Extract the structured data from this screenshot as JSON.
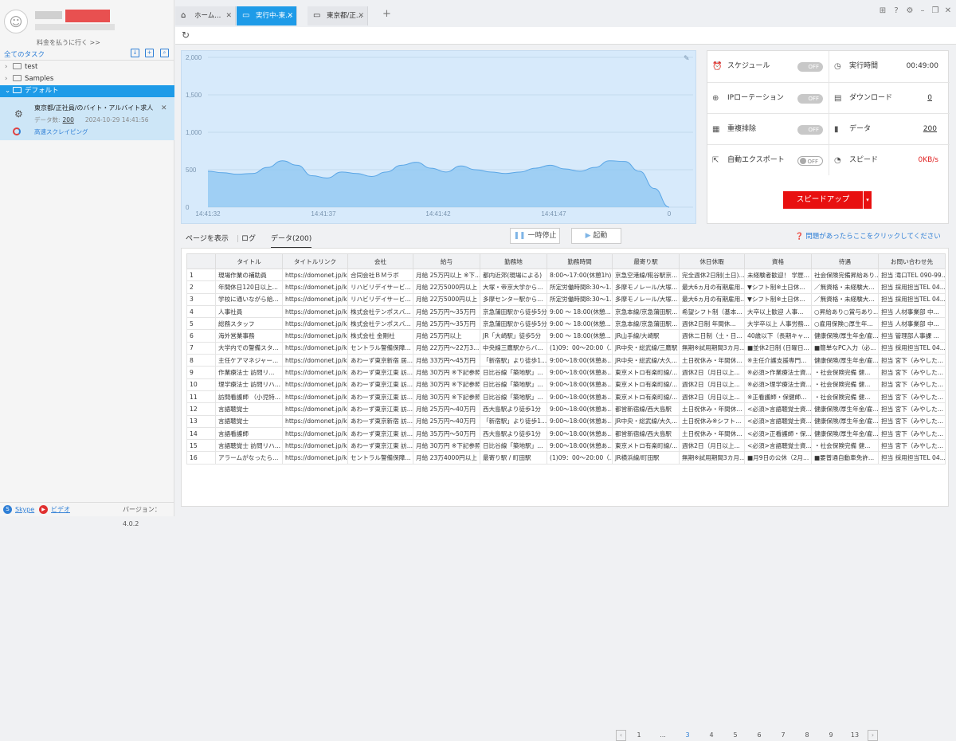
{
  "sidebar": {
    "pay_link": "料金を払うに行く >>",
    "all_tasks": "全てのタスク",
    "tree": [
      {
        "label": "test"
      },
      {
        "label": "Samples"
      },
      {
        "label": "デフォルト"
      }
    ],
    "task": {
      "title": "東京都/正社員/のバイト・アルバイト求人...",
      "data_label": "データ数:",
      "data_count": "200",
      "timestamp": "2024-10-29 14:41:56",
      "mode": "高速スクレイピング"
    },
    "footer": {
      "skype": "Skype",
      "video": "ビデオ",
      "version": "バージョン：4.0.2"
    }
  },
  "tabs": [
    {
      "label": "ホーム..."
    },
    {
      "label": "実行中-東..."
    },
    {
      "label": "東京都/正..."
    }
  ],
  "chart_data": {
    "type": "area",
    "title": "",
    "xlabel": "",
    "ylabel": "",
    "ylim": [
      0,
      2000
    ],
    "yticks": [
      "2,000",
      "1,500",
      "1,000",
      "500",
      "0"
    ],
    "xticks": [
      "14:41:32",
      "14:41:37",
      "14:41:42",
      "14:41:47",
      "0"
    ],
    "values": [
      480,
      460,
      440,
      450,
      530,
      620,
      560,
      420,
      390,
      470,
      450,
      410,
      470,
      560,
      600,
      520,
      470,
      550,
      500,
      470,
      450,
      470,
      520,
      560,
      510,
      480,
      530,
      620,
      610,
      480,
      250,
      0
    ],
    "color": "#8cc5f2"
  },
  "stats": {
    "schedule": "スケジュール",
    "schedule_val": "OFF",
    "runtime": "実行時間",
    "runtime_val": "00:49:00",
    "ip": "IPローテーション",
    "ip_val": "OFF",
    "download": "ダウンロード",
    "download_val": "0",
    "dedupe": "重複排除",
    "dedupe_val": "OFF",
    "data": "データ",
    "data_val": "200",
    "export": "自動エクスポート",
    "export_val": "OFF",
    "speed": "スピード",
    "speed_val": "0KB/s",
    "speedup": "スピードアップ"
  },
  "controls": {
    "page_view": "ページを表示",
    "log": "ログ",
    "data_tab": "データ(200)",
    "pause": "一時停止",
    "start": "起動",
    "help": "問題があったらここをクリックしてください"
  },
  "table": {
    "headers": [
      "",
      "タイトル",
      "タイトルリンク",
      "会社",
      "給与",
      "勤務地",
      "勤務時間",
      "最寄り駅",
      "休日休暇",
      "資格",
      "待遇",
      "お問い合わせ先"
    ],
    "rows": [
      [
        "1",
        "現場作業の補助員",
        "https://domonet.jp/ka...",
        "合同会社ＢＭラボ",
        "月給 25万円以上 ※下...",
        "都内近郊(現場による)",
        "8:00～17:00(休憩1h)...",
        "京急空港線/糀谷駅京...",
        "完全週休2日制(土日)...",
        "未経験者歓迎！ 学歴...",
        "社会保険完備昇給あり...",
        "担当 滝口TEL 090-99..."
      ],
      [
        "2",
        "年間休日120日以上...",
        "https://domonet.jp/ka...",
        "リハビリデイサービ...",
        "月給 22万5000円以上",
        "大塚・帝京大学から...",
        "所定労働時間8:30～1...",
        "多摩モノレール/大塚...",
        "最大6ヵ月の有期雇用...",
        "▼シフト制※土日休...",
        "／無資格・未経験大...",
        "担当 採用担当TEL 04..."
      ],
      [
        "3",
        "学校に通いながら給...",
        "https://domonet.jp/ka...",
        "リハビリデイサービ...",
        "月給 22万5000円以上",
        "多摩センター駅から...",
        "所定労働時間8:30～1...",
        "多摩モノレール/大塚...",
        "最大6ヵ月の有期雇用...",
        "▼シフト制※土日休...",
        "／無資格・未経験大...",
        "担当 採用担当TEL 04..."
      ],
      [
        "4",
        "人事社員",
        "https://domonet.jp/ka...",
        "株式会社テンポスバ...",
        "月給 25万円～35万円",
        "京急蒲田駅から徒歩5分",
        "9:00 ～ 18:00(休憩...",
        "京急本線/京急蒲田駅...",
        "希望シフト制（基本...",
        "大卒以上歓迎 人事...",
        "○昇給あり○賞与あり...",
        "担当 人材事業部 中..."
      ],
      [
        "5",
        "総務スタッフ",
        "https://domonet.jp/ka...",
        "株式会社テンポスバ...",
        "月給 25万円～35万円",
        "京急蒲田駅から徒歩5分",
        "9:00 ～ 18:00(休憩...",
        "京急本線/京急蒲田駅...",
        "週休2日制 年間休...",
        "大学卒以上 人事労務...",
        "○雇用保険○厚生年...",
        "担当 人材事業部 中..."
      ],
      [
        "6",
        "海外営業事務",
        "https://domonet.jp/ka...",
        "株式会社 金剛社",
        "月給 25万円以上",
        "JR「大崎駅」徒歩5分",
        "9:00 ～ 18:00(休憩...",
        "JR山手線/大崎駅",
        "週休二日制（土・日...",
        "40歳以下（長期キャ...",
        "健康保険/厚生年金/雇...",
        "担当 管理部人事課 ..."
      ],
      [
        "7",
        "大学内での警備スタ...",
        "https://domonet.jp/ka...",
        "セントラル警備保障...",
        "月給 22万円～22万3...",
        "中央線三鷹駅からバ...",
        "(1)09：00～20:00（...",
        "JR中央・総武線/三鷹駅",
        "無期※試用期間3カ月...",
        "■並休2日制 (日曜日...",
        "■簡単なPC入力（必...",
        "担当 採用担当TEL 04..."
      ],
      [
        "8",
        "主任ケアマネジャー...",
        "https://domonet.jp/ka...",
        "あわーず東京新宿 居...",
        "月給 33万円～45万円",
        "「新宿駅」より徒歩1...",
        "9:00～18:00(休憩あ...",
        "JR中央・総武線/大久...",
        "土日祝休み・年間休...",
        "※主任介護支援専門...",
        "健康保険/厚生年金/雇...",
        "担当 宮下（みやした..."
      ],
      [
        "9",
        "作業療法士 訪問リ...",
        "https://domonet.jp/ka...",
        "あわーず東京江東 訪...",
        "月給 30万円 ※下記参照",
        "日比谷線「築地駅」...",
        "9:00～18:00(休憩あ...",
        "東京メトロ有楽町線/...",
        "週休2日（月日以上...",
        "※必須>作業療法士資...",
        "・社会保険完備 健...",
        "担当 宮下（みやした..."
      ],
      [
        "10",
        "理学療法士 訪問リハ...",
        "https://domonet.jp/ka...",
        "あわーず東京江東 訪...",
        "月給 30万円 ※下記参照",
        "日比谷線「築地駅」...",
        "9:00～18:00(休憩あ...",
        "東京メトロ有楽町線/...",
        "週休2日（月日以上...",
        "※必須>理学療法士資...",
        "・社会保険完備 健...",
        "担当 宮下（みやした..."
      ],
      [
        "11",
        "訪問看護師 （小児特...",
        "https://domonet.jp/ka...",
        "あわーず東京江東 訪...",
        "月給 30万円 ※下記参照",
        "日比谷線「築地駅」...",
        "9:00～18:00(休憩あ...",
        "東京メトロ有楽町線/...",
        "週休2日（月日以上...",
        "※正看護師・保健師...",
        "・社会保険完備 健...",
        "担当 宮下（みやした..."
      ],
      [
        "12",
        "言語聴覚士",
        "https://domonet.jp/ka...",
        "あわーず東京江東 訪...",
        "月給 25万円～40万円",
        "西大島駅より徒歩1分",
        "9:00～18:00(休憩あ...",
        "都営新宿線/西大島駅",
        "土日祝休み・年間休...",
        "<必須>言語聴覚士資...",
        "健康保険/厚生年金/雇...",
        "担当 宮下（みやした..."
      ],
      [
        "13",
        "言語聴覚士",
        "https://domonet.jp/ka...",
        "あわーず東京新宿 訪...",
        "月給 25万円～40万円",
        "「新宿駅」より徒歩1...",
        "9:00～18:00(休憩あ...",
        "JR中央・総武線/大久...",
        "土日祝休み※シフト...",
        "<必須>言語聴覚士資...",
        "健康保険/厚生年金/雇...",
        "担当 宮下（みやした..."
      ],
      [
        "14",
        "言語看護師",
        "https://domonet.jp/ka...",
        "あわーず東京江東 訪...",
        "月給 35万円～50万円",
        "西大島駅より徒歩1分",
        "9:00～18:00(休憩あ...",
        "都営新宿線/西大島駅",
        "土日祝休み・年間休...",
        "<必須>正看護師・保...",
        "健康保険/厚生年金/雇...",
        "担当 宮下（みやした..."
      ],
      [
        "15",
        "言語聴覚士 訪問リハ...",
        "https://domonet.jp/ka...",
        "あわーず東京江東 訪...",
        "月給 30万円 ※下記参照",
        "日比谷線「築地駅」...",
        "9:00～18:00(休憩あ...",
        "東京メトロ有楽町線/...",
        "週休2日（月日以上...",
        "<必須>言語聴覚士資...",
        "・社会保険完備 健...",
        "担当 宮下（みやした..."
      ],
      [
        "16",
        "アラームがなったら...",
        "https://domonet.jp/ka...",
        "セントラル警備保障...",
        "月給 23万4000円以上",
        "最寄り駅 / 町田駅",
        "(1)09：00～20:00（...",
        "JR横浜線/町田駅",
        "無期※試用期間3カ月...",
        "■月9日の公休（2月...",
        "■要普通自動車免許...",
        "担当 採用担当TEL 04..."
      ]
    ]
  },
  "pager": {
    "pages": [
      "1",
      "...",
      "3",
      "4",
      "5",
      "6",
      "7",
      "8",
      "9",
      "13"
    ],
    "current": "3"
  }
}
